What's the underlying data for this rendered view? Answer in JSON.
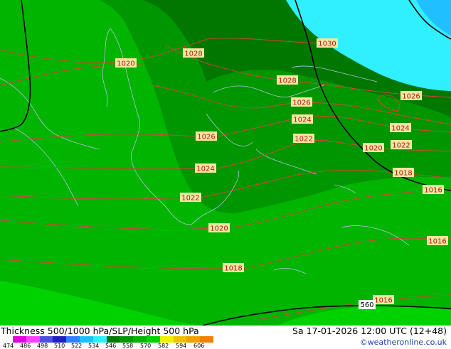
{
  "map": {
    "pressure_labels": [
      {
        "text": "1030"
      },
      {
        "text": "1028"
      },
      {
        "text": "1028"
      },
      {
        "text": "1026"
      },
      {
        "text": "1026"
      },
      {
        "text": "1026"
      },
      {
        "text": "1024"
      },
      {
        "text": "1024"
      },
      {
        "text": "1024"
      },
      {
        "text": "1022"
      },
      {
        "text": "1022"
      },
      {
        "text": "1022"
      },
      {
        "text": "1020"
      },
      {
        "text": "1020"
      },
      {
        "text": "1020"
      },
      {
        "text": "1018"
      },
      {
        "text": "1018"
      },
      {
        "text": "1016"
      },
      {
        "text": "1016"
      },
      {
        "text": "1016"
      }
    ],
    "height_label": "560",
    "colors": {
      "thickness_534": "#009600",
      "thickness_540": "#00b400",
      "thickness_546": "#00d200",
      "thickness_528": "#007800",
      "cold_air": "#30f0ff",
      "cold_air_core": "#20c0ff",
      "isobar": "#d94040",
      "coast": "#b0c4d8"
    }
  },
  "footer": {
    "title": "Thickness 500/1000 hPa/SLP/Height 500 hPa",
    "datetime": "Sa 17-01-2026 12:00 UTC (12+48)",
    "credit": "©weatheronline.co.uk",
    "legend_ticks": [
      "474",
      "486",
      "498",
      "510",
      "522",
      "534",
      "546",
      "558",
      "570",
      "582",
      "594",
      "606"
    ],
    "legend_colors": [
      "#e000e0",
      "#ff40ff",
      "#5050e0",
      "#2020c0",
      "#3080ff",
      "#20c0ff",
      "#30f0ff",
      "#007800",
      "#009600",
      "#00b400",
      "#00d200",
      "#f0f000",
      "#f0c000",
      "#f0a000",
      "#f08000"
    ]
  }
}
